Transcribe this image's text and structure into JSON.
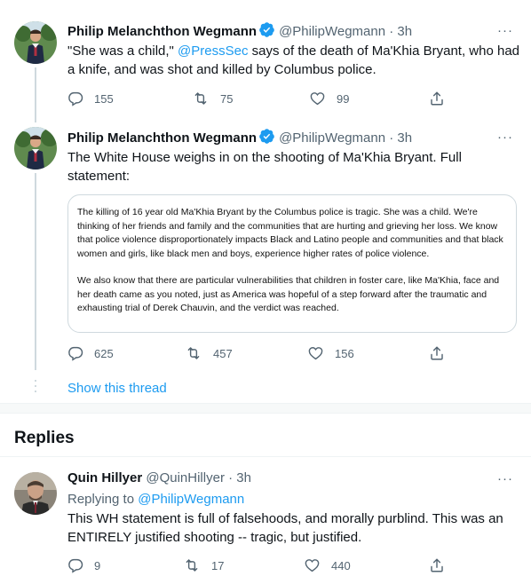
{
  "colors": {
    "accent": "#1d9bf0",
    "secondary_text": "#536471",
    "border": "#cfd9de"
  },
  "tweet1": {
    "name": "Philip Melanchthon Wegmann",
    "handle": "@PhilipWegmann",
    "separator": "·",
    "time": "3h",
    "more": "···",
    "text_pre": "\"She was a child,\" ",
    "mention": "@PressSec",
    "text_post": " says of the death of Ma'Khia Bryant, who had a knife, and was shot and killed by Columbus police.",
    "replies": "155",
    "retweets": "75",
    "likes": "99"
  },
  "tweet2": {
    "name": "Philip Melanchthon Wegmann",
    "handle": "@PhilipWegmann",
    "separator": "·",
    "time": "3h",
    "more": "···",
    "text": "The White House weighs in on the shooting of Ma'Khia Bryant. Full statement:",
    "statement_p1": "The killing of 16 year old Ma'Khia Bryant by the Columbus police is tragic. She was a child. We're thinking of her friends and family and the communities that are hurting and grieving her loss. We know that police violence disproportionately impacts Black and Latino people and communities and that black women and girls, like black men and boys, experience higher rates of police violence.",
    "statement_p2": "We also know that there are particular vulnerabilities that children in foster care, like Ma'Khia, face and her death came as you noted, just as America was hopeful of a step forward after the traumatic and exhausting trial of Derek Chauvin, and the verdict was reached.",
    "replies": "625",
    "retweets": "457",
    "likes": "156"
  },
  "show_thread": "Show this thread",
  "replies_heading": "Replies",
  "reply1": {
    "name": "Quin Hillyer",
    "handle": "@QuinHillyer",
    "separator": "·",
    "time": "3h",
    "more": "···",
    "replying_to_label": "Replying to ",
    "replying_to_handle": "@PhilipWegmann",
    "text": "This WH statement is full of falsehoods, and morally purblind. This was an ENTIRELY justified shooting -- tragic, but justified.",
    "replies": "9",
    "retweets": "17",
    "likes": "440"
  },
  "icons": [
    "verified-badge-icon",
    "reply-icon",
    "retweet-icon",
    "like-icon",
    "share-icon",
    "more-icon"
  ]
}
